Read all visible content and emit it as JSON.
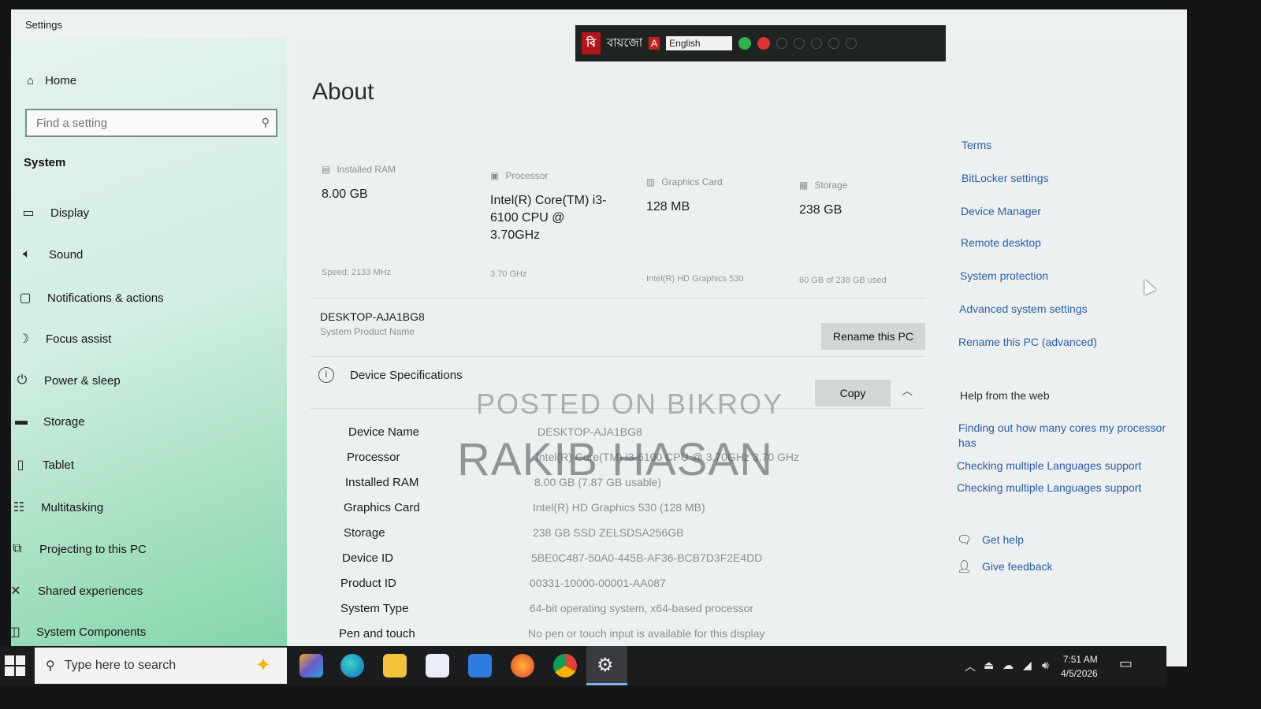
{
  "window": {
    "title": "Settings",
    "minimize": "—",
    "restore": "❐",
    "close": "✕"
  },
  "langbar": {
    "bn_logo": "বি",
    "bn_name": "বায়জো",
    "lang": "English"
  },
  "sidebar": {
    "home": "Home",
    "search_placeholder": "Find a setting",
    "section": "System",
    "items": [
      {
        "label": "Display",
        "icon": "display-icon"
      },
      {
        "label": "Sound",
        "icon": "sound-icon"
      },
      {
        "label": "Notifications & actions",
        "icon": "notifications-icon"
      },
      {
        "label": "Focus assist",
        "icon": "focus-assist-icon"
      },
      {
        "label": "Power & sleep",
        "icon": "power-icon"
      },
      {
        "label": "Storage",
        "icon": "storage-icon"
      },
      {
        "label": "Tablet",
        "icon": "tablet-icon"
      },
      {
        "label": "Multitasking",
        "icon": "multitasking-icon"
      },
      {
        "label": "Projecting to this PC",
        "icon": "projecting-icon"
      },
      {
        "label": "Shared experiences",
        "icon": "shared-icon"
      },
      {
        "label": "System Components",
        "icon": "components-icon"
      }
    ]
  },
  "main": {
    "title": "About",
    "stats": [
      {
        "label": "Installed RAM",
        "value": "8.00 GB",
        "sub": "Speed: 2133 MHz"
      },
      {
        "label": "Processor",
        "value": "Intel(R) Core(TM) i3-6100 CPU @ 3.70GHz",
        "sub": "3.70 GHz"
      },
      {
        "label": "Graphics Card",
        "value": "128 MB",
        "sub": "Intel(R) HD Graphics 530"
      },
      {
        "label": "Storage",
        "value": "238 GB",
        "sub": "60 GB of 238 GB used"
      }
    ],
    "pc_name": "DESKTOP-AJA1BG8",
    "pc_sub": "System Product Name",
    "rename_btn": "Rename this PC",
    "spec_title": "Device Specifications",
    "copy_btn": "Copy",
    "specs": [
      {
        "k": "Device Name",
        "v": "DESKTOP-AJA1BG8"
      },
      {
        "k": "Processor",
        "v": "Intel(R) Core(TM) i3-6100 CPU @ 3.70GHz   3.70 GHz"
      },
      {
        "k": "Installed RAM",
        "v": "8.00 GB (7.87 GB usable)"
      },
      {
        "k": "Graphics Card",
        "v": "Intel(R) HD Graphics 530 (128 MB)"
      },
      {
        "k": "Storage",
        "v": "238 GB SSD ZELSDSA256GB"
      },
      {
        "k": "Device ID",
        "v": "5BE0C487-50A0-445B-AF36-BCB7D3F2E4DD"
      },
      {
        "k": "Product ID",
        "v": "00331-10000-00001-AA087"
      },
      {
        "k": "System Type",
        "v": "64-bit operating system, x64-based processor"
      },
      {
        "k": "Pen and touch",
        "v": "No pen or touch input is available for this display"
      }
    ]
  },
  "right": {
    "links": [
      "Terms",
      "BitLocker settings",
      "Device Manager",
      "Remote desktop",
      "System protection",
      "Advanced system settings",
      "Rename this PC (advanced)"
    ],
    "help_title": "Help from the web",
    "help_links": [
      "Finding out how many cores my processor has",
      "Checking multiple Languages support",
      "Checking multiple Languages support"
    ],
    "get_help": "Get help",
    "give_feedback": "Give feedback"
  },
  "watermark": {
    "line1": "POSTED ON BIKROY",
    "line2": "RAKIB HASAN"
  },
  "taskbar": {
    "search_placeholder": "Type here to search",
    "time": "7:51 AM",
    "date": "4/5/2026"
  }
}
